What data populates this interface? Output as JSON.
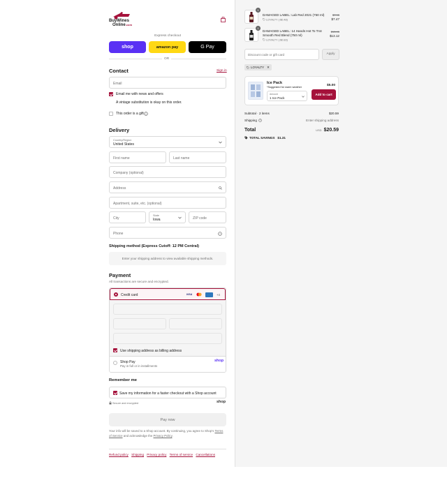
{
  "brand": {
    "logo_line1": "BuyWines",
    "logo_line2": "Online",
    "logo_suffix": ".com"
  },
  "express": {
    "title": "Express checkout",
    "or": "OR",
    "shop_label": "shop",
    "amazon_label": "amazon pay",
    "gpay_label": "G Pay"
  },
  "contact": {
    "title": "Contact",
    "sign_in": "Sign in",
    "email_placeholder": "Email",
    "news_label": "Email me with news and offers",
    "vintage_label": "A vintage substitution is okay on this order.",
    "gift_label": "This order is a gift"
  },
  "delivery": {
    "title": "Delivery",
    "country_label": "Country/Region",
    "country_value": "United States",
    "first_name": "First name",
    "last_name": "Last name",
    "company": "Company (optional)",
    "address": "Address",
    "apartment": "Apartment, suite, etc. (optional)",
    "city": "City",
    "state_label": "State",
    "state_value": "Iowa",
    "zip": "ZIP code",
    "phone": "Phone"
  },
  "shipping": {
    "title": "Shipping method (Express Cutoff: 12 PM Central)",
    "notice": "Enter your shipping address to view available shipping methods."
  },
  "payment": {
    "title": "Payment",
    "subtitle": "All transactions are secure and encrypted.",
    "credit_card": "Credit card",
    "more_cards": "+4",
    "billing_label": "Use shipping address as billing address",
    "shop_pay": "Shop Pay",
    "shop_pay_sub": "Pay in full or in installments",
    "shop_pay_logo": "shop",
    "card_visa": "VISA"
  },
  "remember": {
    "title": "Remember me",
    "save_label": "Save my information for a faster checkout with a Shop account",
    "secure": "Secure and encrypted",
    "shop_logo": "shop"
  },
  "pay_button": "Pay now",
  "legal": {
    "text1": "Your info will be saved to a Shop account. By continuing, you agree to Shop's",
    "tos": "Terms of Service",
    "and": "and acknowledge the",
    "privacy": "Privacy Policy",
    "period": "."
  },
  "footer_links": [
    "Refund policy",
    "Shipping",
    "Privacy policy",
    "Terms of service",
    "Cancellations"
  ],
  "cart": {
    "items": [
      {
        "qty": "1",
        "name": "DAMAGED LABEL: Lab Red 2021 (750 ml)",
        "discount": "LOYALTY (-$0.48)",
        "old_price": "$7.95",
        "price": "$7.47"
      },
      {
        "qty": "1",
        "name": "DAMAGED LABEL: 14 Hands Hot To Trot Smooth Red Blend (750 ml)",
        "discount": "LOYALTY (-$0.83)",
        "old_price": "$13.95",
        "price": "$13.12"
      }
    ],
    "discount_placeholder": "Discount code or gift card",
    "apply": "Apply",
    "loyalty_tag": "LOYALTY",
    "upsell": {
      "name": "Ice Pack",
      "note": "*Suggested for warm weather",
      "price": "$5.00",
      "amount_label": "Amount",
      "amount_value": "1 Ice Pack",
      "add_button": "Add to cart"
    },
    "subtotal_label": "Subtotal · 2 items",
    "subtotal_value": "$20.59",
    "shipping_label": "Shipping",
    "shipping_value": "Enter shipping address",
    "total_label": "Total",
    "currency": "USD",
    "total_value": "$20.59",
    "savings_label": "TOTAL SAVINGS",
    "savings_value": "$1.31"
  },
  "colors": {
    "accent": "#a5123b",
    "shop_purple": "#5a31f4",
    "amazon_yellow": "#ffd814"
  }
}
